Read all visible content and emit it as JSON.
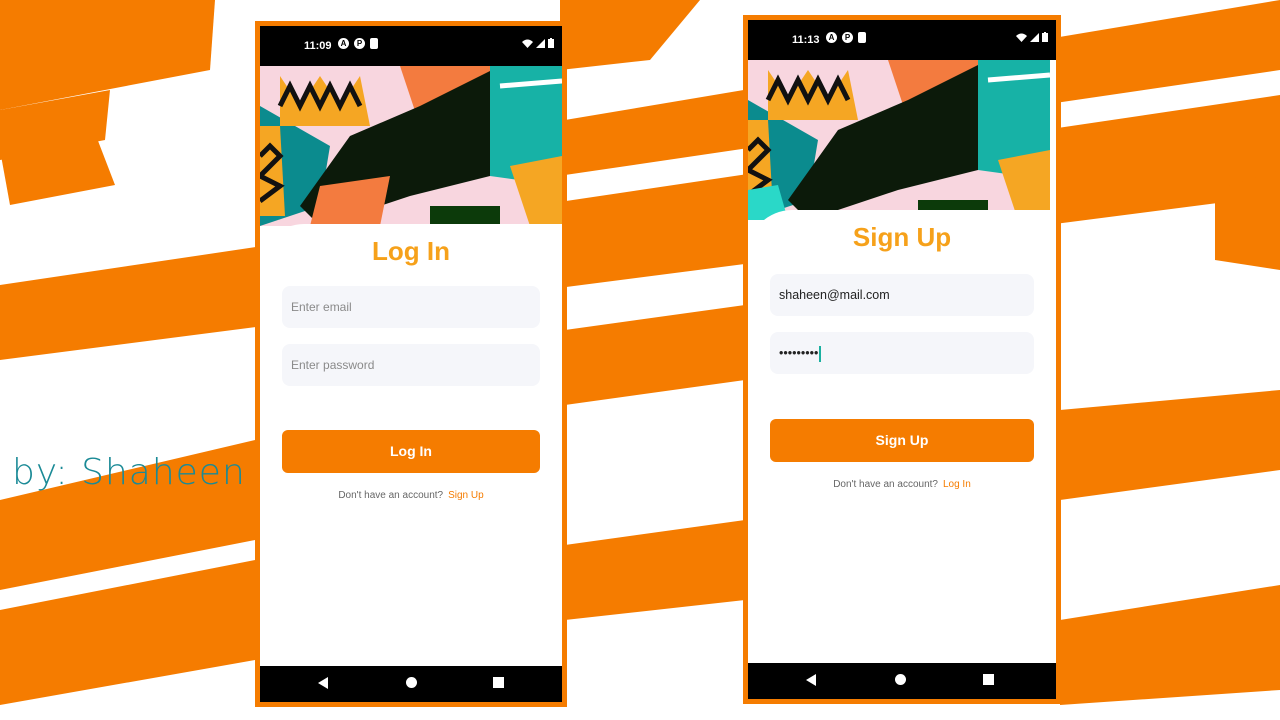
{
  "author_credit": "by: Shaheen",
  "colors": {
    "accent": "#f57c00",
    "title": "#f6a11a",
    "credit": "#1a8a96",
    "field_bg": "#f5f6fa"
  },
  "screens": [
    {
      "status_time": "11:09",
      "title": "Log In",
      "email_placeholder": "Enter email",
      "email_value": "",
      "password_placeholder": "Enter password",
      "password_value": "",
      "button_label": "Log In",
      "footer_text": "Don't have an account?",
      "footer_link": "Sign Up"
    },
    {
      "status_time": "11:13",
      "title": "Sign Up",
      "email_placeholder": "",
      "email_value": "shaheen@mail.com",
      "password_placeholder": "",
      "password_value": "•••••••••",
      "button_label": "Sign Up",
      "footer_text": "Don't have an account?",
      "footer_link": "Log In"
    }
  ],
  "icons": [
    "wifi-icon",
    "signal-icon",
    "battery-icon",
    "back-nav-icon",
    "home-nav-icon",
    "recents-nav-icon"
  ]
}
